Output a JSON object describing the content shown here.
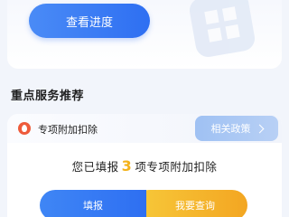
{
  "top": {
    "progress_button": "查看进度"
  },
  "section": {
    "title": "重点服务推荐"
  },
  "service": {
    "icon": "flame-icon",
    "name": "专项附加扣除",
    "policy_button": "相关政策",
    "filed_prefix": "您已填报",
    "filed_count": "3",
    "filed_suffix": "项专项附加扣除",
    "fill_button": "填报",
    "query_button": "我要查询"
  },
  "colors": {
    "primary_blue": "#2e6ff2",
    "accent_orange": "#f3a622",
    "count_highlight": "#f3b21a",
    "icon_red": "#ee5b3b"
  }
}
